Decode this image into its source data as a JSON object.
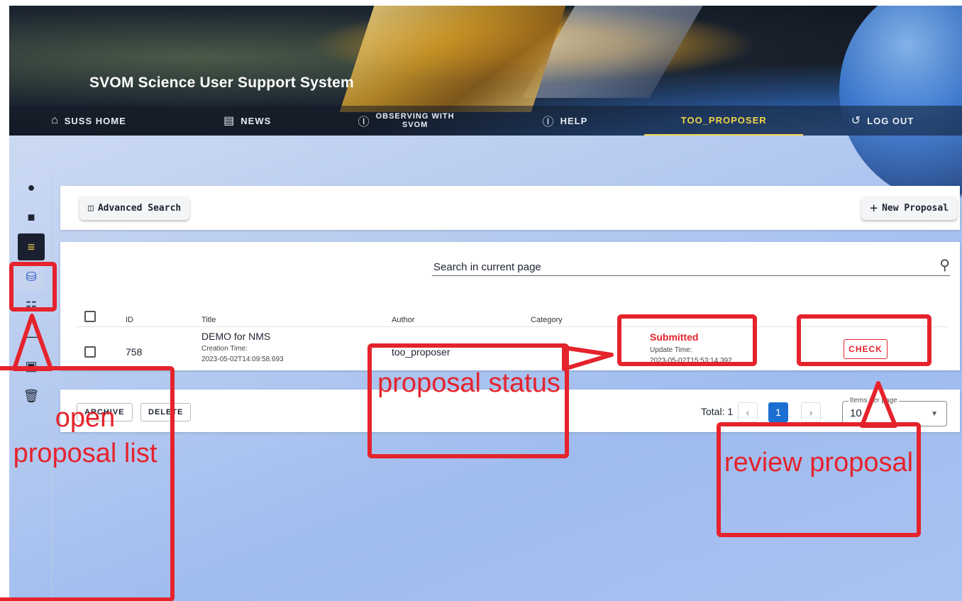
{
  "header": {
    "title": "SVOM Science User Support System",
    "nav": [
      {
        "label": "SUSS HOME",
        "icon": "home-icon"
      },
      {
        "label": "NEWS",
        "icon": "news-icon"
      },
      {
        "label": "OBSERVING WITH SVOM",
        "icon": "help-circle-icon"
      },
      {
        "label": "HELP",
        "icon": "help-circle-icon"
      },
      {
        "label": "TOO_PROPOSER",
        "icon": ""
      },
      {
        "label": "LOG OUT",
        "icon": "logout-icon"
      }
    ],
    "active_nav": "TOO_PROPOSER",
    "nav_line1": "OBSERVING WITH",
    "nav_line2": "SVOM"
  },
  "sidebar": {
    "items": [
      {
        "icon": "person-icon"
      },
      {
        "icon": "chat-icon"
      },
      {
        "icon": "list-icon",
        "state": "dark"
      },
      {
        "icon": "database-icon",
        "state": "selected"
      },
      {
        "icon": "documents-icon"
      },
      {
        "icon": "divider-icon"
      },
      {
        "icon": "archive-icon"
      },
      {
        "icon": "trash-icon"
      }
    ]
  },
  "toolbar": {
    "advanced_search": "Advanced Search",
    "new_proposal": "New Proposal"
  },
  "table": {
    "search_placeholder": "Search in current page",
    "columns": [
      "ID",
      "Title",
      "Author",
      "Category"
    ],
    "rows": [
      {
        "id": "758",
        "title": "DEMO for NMS",
        "creation_label": "Creation Time:",
        "creation_time": "2023-05-02T14:09:58.693",
        "author": "too_proposer",
        "status": "Submitted",
        "update_label": "Update Time:",
        "update_time": "2023-05-02T15:53:14.392",
        "action": "CHECK"
      }
    ]
  },
  "footer": {
    "archive": "ARCHIVE",
    "delete": "DELETE",
    "total": "Total: 1",
    "current_page": "1",
    "items_per_page_label": "Items per page",
    "items_per_page": "10"
  },
  "annotations": {
    "open_list": "open proposal list",
    "status": "proposal status",
    "review": "review proposal"
  },
  "colors": {
    "annotation": "#e5232c",
    "active_nav": "#f3d64a",
    "page_active": "#1c6fd1"
  }
}
